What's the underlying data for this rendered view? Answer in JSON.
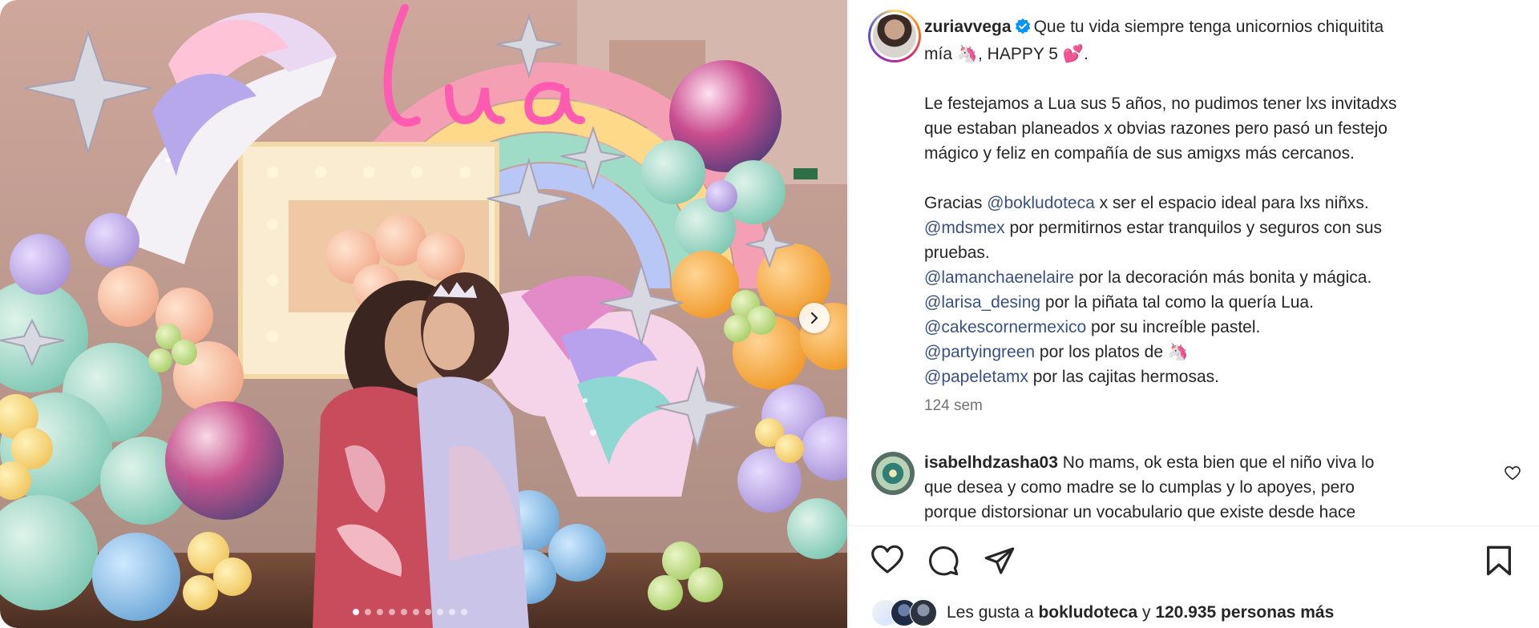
{
  "post": {
    "username": "zuriavvega",
    "caption_lines": [
      "Que tu vida siempre tenga unicornios chiquitita",
      "mía 🦄, HAPPY 5 💕."
    ],
    "body_para1": [
      "Le festejamos a Lua sus 5 años, no pudimos tener lxs invitadxs",
      "que estaban planeados x obvias razones pero pasó un festejo",
      "mágico y feliz en compañía de sus amigxs más cercanos."
    ],
    "thanks": {
      "prefix": "Gracias ",
      "m1": "@bokludoteca",
      "t1": " x ser el espacio ideal para lxs niñxs.",
      "m2": "@mdsmex",
      "t2a": " por permitirnos estar tranquilos y seguros con sus",
      "t2b": "pruebas.",
      "m3": "@lamanchaenelaire",
      "t3": " por la decoración más bonita y mágica.",
      "m4": "@larisa_desing",
      "t4": " por la piñata tal como la quería Lua.",
      "m5": "@cakescornermexico",
      "t5": " por su increíble pastel.",
      "m6": "@partyingreen",
      "t6": " por los platos de 🦄",
      "m7": "@papeletamx",
      "t7": " por las cajitas hermosas."
    },
    "timestamp": "124 sem",
    "media_text": "Lua"
  },
  "comment": {
    "username": "isabelhdzasha03",
    "lines": [
      " No mams, ok esta bien que el niño viva lo",
      "que desea y como madre se lo cumplas y lo apoyes, pero",
      "porque distorsionar un vocabulario que existe desde hace"
    ]
  },
  "likes": {
    "prefix": "Les gusta a ",
    "user": "bokludoteca",
    "mid": " y ",
    "count": "120.935 personas más"
  },
  "carousel": {
    "total": 10,
    "active_index": 0
  },
  "icons": {
    "verified": "verified-badge-icon",
    "like": "heart-icon",
    "comment": "comment-icon",
    "share": "share-icon",
    "save": "bookmark-icon",
    "next": "chevron-right-icon"
  },
  "colors": {
    "mention": "#385185",
    "verified": "#0095f6",
    "muted": "#737373"
  }
}
